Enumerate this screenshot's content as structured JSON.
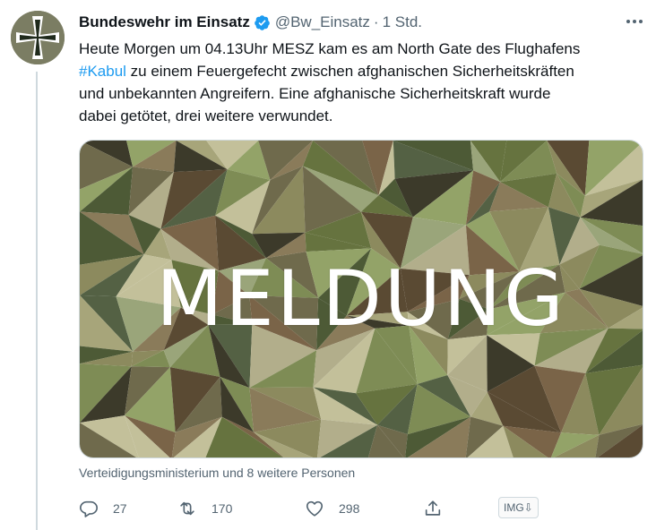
{
  "tweet": {
    "author_name": "Bundeswehr im Einsatz",
    "handle": "@Bw_Einsatz",
    "separator": "·",
    "time": "1 Std.",
    "text_line1": "Heute Morgen um 04.13Uhr MESZ kam es am North Gate des Flughafens",
    "hashtag": "#Kabul",
    "text_line2_rest": " zu einem Feuergefecht zwischen afghanischen Sicherheitskräften",
    "text_line3": "und unbekannten Angreifern. Eine afghanische Sicherheitskraft wurde",
    "text_line4": "dabei getötet, drei weitere verwundet.",
    "media_title": "MELDUNG",
    "tagged": "Verteidigungsministerium und 8 weitere Personen"
  },
  "actions": {
    "reply_count": "27",
    "retweet_count": "170",
    "like_count": "298",
    "img_label": "IMG⇩"
  },
  "icons": {
    "verified": "verified-badge-icon",
    "more": "more-horizontal-icon",
    "reply": "reply-icon",
    "retweet": "retweet-icon",
    "like": "heart-icon",
    "share": "share-icon"
  },
  "colors": {
    "accent": "#1d9bf0",
    "secondary_text": "#536471",
    "text": "#0f1419",
    "thread_line": "#cfd9de"
  }
}
